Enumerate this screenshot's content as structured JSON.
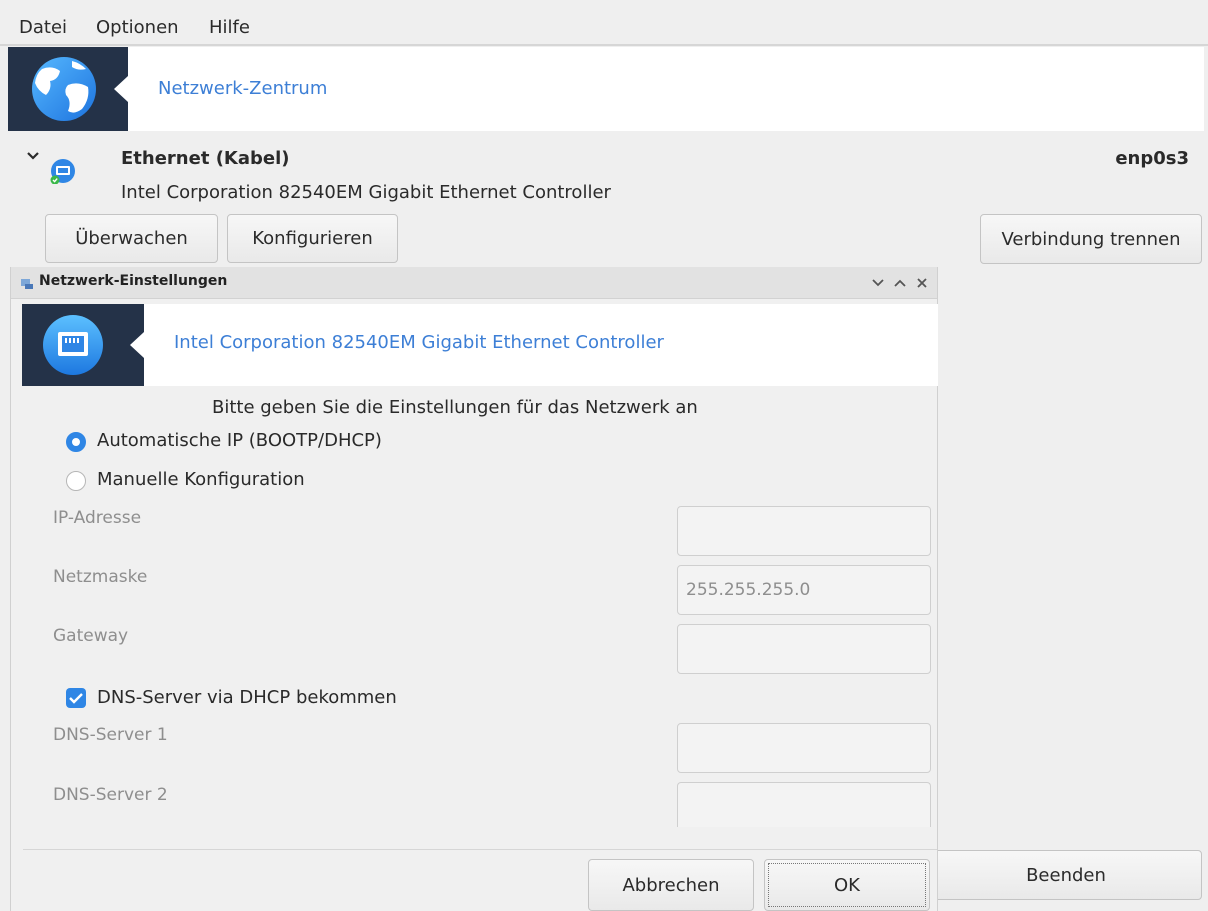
{
  "menu": [
    "Datei",
    "Optionen",
    "Hilfe"
  ],
  "banner": {
    "title": "Netzwerk-Zentrum",
    "icon": "globe-icon"
  },
  "device": {
    "name": "Ethernet (Kabel)",
    "description": "Intel Corporation 82540EM Gigabit Ethernet Controller",
    "interface": "enp0s3",
    "buttons": {
      "monitor": "Überwachen",
      "configure": "Konfigurieren",
      "disconnect": "Verbindung trennen"
    }
  },
  "dialog": {
    "title": "Netzwerk-Einstellungen",
    "banner_title": "Intel Corporation 82540EM Gigabit Ethernet Controller",
    "prompt": "Bitte geben Sie die Einstellungen für das Netzwerk an",
    "options": {
      "auto": "Automatische IP (BOOTP/DHCP)",
      "manual": "Manuelle Konfiguration",
      "selected": "auto"
    },
    "fields": {
      "ip": {
        "label": "IP-Adresse",
        "value": ""
      },
      "netmask": {
        "label": "Netzmaske",
        "value": "255.255.255.0"
      },
      "gateway": {
        "label": "Gateway",
        "value": ""
      },
      "dns_checkbox": {
        "label": "DNS-Server via DHCP bekommen",
        "checked": true
      },
      "dns1": {
        "label": "DNS-Server 1",
        "value": ""
      },
      "dns2": {
        "label": "DNS-Server 2",
        "value": ""
      }
    },
    "buttons": {
      "cancel": "Abbrechen",
      "ok": "OK"
    }
  },
  "footer": {
    "quit": "Beenden"
  },
  "colors": {
    "accent": "#2f86e5",
    "link": "#3d7fd6",
    "icon_bg": "#243248"
  }
}
